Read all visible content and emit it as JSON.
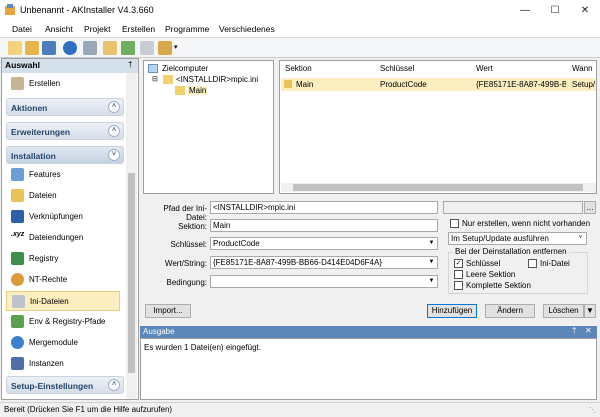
{
  "window": {
    "title": "Unbenannt - AKInstaller V4.3.660"
  },
  "menu": [
    "Datei",
    "Ansicht",
    "Projekt",
    "Erstellen",
    "Programme",
    "Verschiedenes"
  ],
  "sidebar": {
    "title": "Auswahl",
    "top_item": "Erstellen",
    "groups": [
      "Aktionen",
      "Erweiterungen",
      "Installation",
      "Setup-Einstellungen"
    ],
    "items": [
      "Features",
      "Dateien",
      "Verknüpfungen",
      "Dateiendungen",
      "Registry",
      "NT-Rechte",
      "Ini-Dateien",
      "Env & Registry-Pfade",
      "Mergemodule",
      "Instanzen"
    ]
  },
  "tree": {
    "root": "Zielcomputer",
    "child": "<INSTALLDIR>mpic.ini",
    "leaf": "Main"
  },
  "list": {
    "headers": [
      "Sektion",
      "Schlüssel",
      "Wert",
      "Wann"
    ],
    "rows": [
      [
        "Main",
        "ProductCode",
        "{FE85171E-8A87-499B-BB...",
        "Setup/..."
      ]
    ]
  },
  "form": {
    "pfad_label": "Pfad der Ini-Datei:",
    "pfad_value": "<INSTALLDIR>mpic.ini",
    "sektion_label": "Sektion:",
    "sektion_value": "Main",
    "schluessel_label": "Schlüssel:",
    "schluessel_value": "ProductCode",
    "wert_label": "Wert/String:",
    "wert_value": "{FE85171E-8A87-499B-BB66-D414E04D6F4A}",
    "bedingung_label": "Bedingung:",
    "bedingung_value": "",
    "nur_erstellen": "Nur erstellen, wenn nicht vorhanden",
    "wann_value": "Im Setup/Update ausführen",
    "deinstall_group": "Bei der Deinstallation entfernen",
    "cb_schluessel": "Schlüssel",
    "cb_ini": "Ini-Datei",
    "cb_leere": "Leere Sektion",
    "cb_komplett": "Komplette Sektion",
    "import_btn": "Import...",
    "hinzufuegen_btn": "Hinzufügen",
    "aendern_btn": "Ändern",
    "loeschen_btn": "Löschen"
  },
  "output": {
    "title": "Ausgabe",
    "text": "Es wurden 1 Datei(en) eingefügt."
  },
  "status": "Bereit (Drücken Sie F1 um die Hilfe aufzurufen)"
}
